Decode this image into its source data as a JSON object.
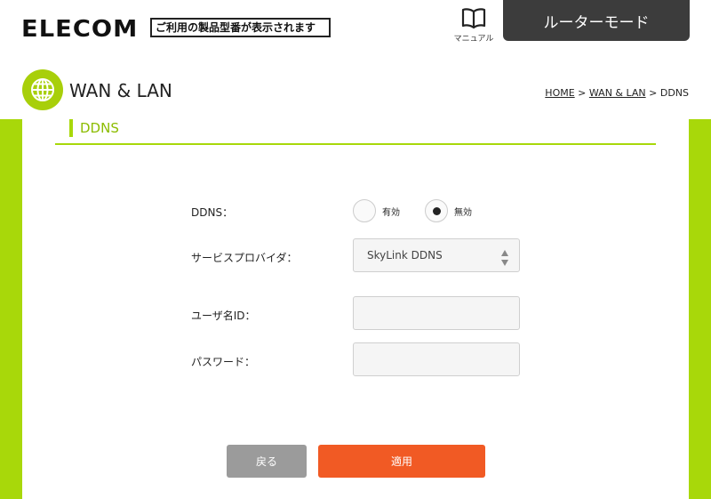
{
  "header": {
    "logo_text": "ELECOM",
    "model_notice": "ご利用の製品型番が表示されます",
    "manual_label": "マニュアル",
    "mode_button": "ルーターモード"
  },
  "page": {
    "title": "WAN & LAN",
    "breadcrumb": {
      "home": "HOME",
      "sep1": " > ",
      "section": "WAN & LAN",
      "sep2": " > ",
      "current": "DDNS"
    }
  },
  "section": {
    "title": "DDNS"
  },
  "form": {
    "ddns_label": "DDNS：",
    "ddns_options": [
      {
        "label": "有効",
        "checked": false
      },
      {
        "label": "無効",
        "checked": true
      }
    ],
    "provider_label": "サービスプロバイダ：",
    "provider_value": "SkyLink DDNS",
    "user_label": "ユーザ名ID：",
    "user_value": "",
    "password_label": "パスワード：",
    "password_value": ""
  },
  "buttons": {
    "back": "戻る",
    "apply": "適用"
  },
  "colors": {
    "accent_green": "#a8d80a",
    "apply_orange": "#f15a24",
    "back_gray": "#9b9b9b",
    "mode_dark": "#3c3c3c"
  },
  "icons": {
    "manual": "book-icon",
    "section": "globe-icon",
    "select": "updown-arrows-icon"
  }
}
